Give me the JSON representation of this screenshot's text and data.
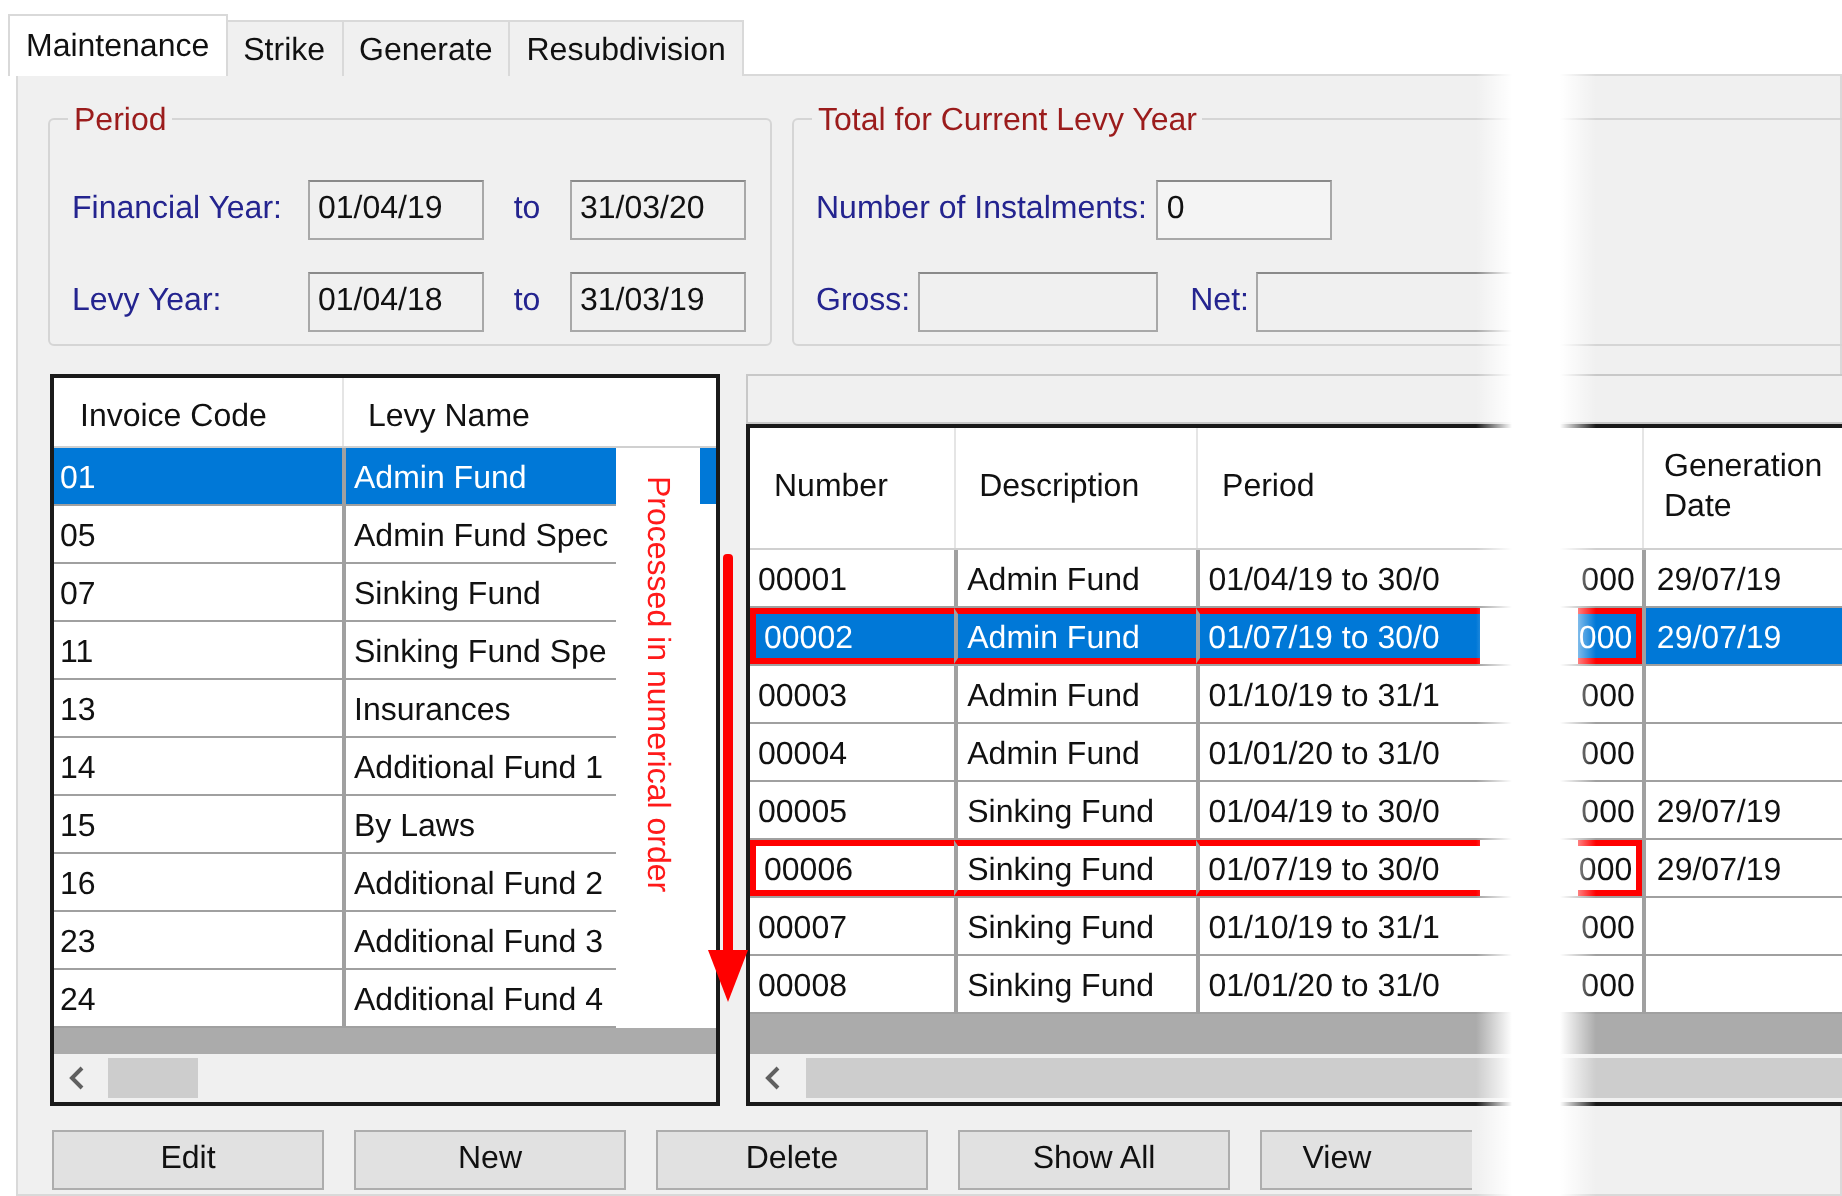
{
  "tabs": [
    {
      "label": "Maintenance",
      "selected": true
    },
    {
      "label": "Strike",
      "selected": false
    },
    {
      "label": "Generate",
      "selected": false
    },
    {
      "label": "Resubdivision",
      "selected": false
    }
  ],
  "period": {
    "title": "Period",
    "rows": [
      {
        "label": "Financial Year:",
        "from": "01/04/19",
        "to_label": "to",
        "to": "31/03/20"
      },
      {
        "label": "Levy Year:",
        "from": "01/04/18",
        "to_label": "to",
        "to": "31/03/19"
      }
    ]
  },
  "totals": {
    "title": "Total for Current Levy Year",
    "instalments": {
      "label": "Number of Instalments:",
      "value": "0"
    },
    "gross": {
      "label": "Gross:"
    },
    "net": {
      "label": "Net:"
    }
  },
  "levy_table": {
    "columns": [
      "Invoice Code",
      "Levy Name"
    ],
    "rows": [
      {
        "code": "01",
        "name": "Admin Fund",
        "selected": true
      },
      {
        "code": "05",
        "name": "Admin Fund Spec",
        "selected": false
      },
      {
        "code": "07",
        "name": "Sinking Fund",
        "selected": false
      },
      {
        "code": "11",
        "name": "Sinking Fund Spe",
        "selected": false
      },
      {
        "code": "13",
        "name": "Insurances",
        "selected": false
      },
      {
        "code": "14",
        "name": "Additional Fund 1",
        "selected": false
      },
      {
        "code": "15",
        "name": "By Laws",
        "selected": false
      },
      {
        "code": "16",
        "name": "Additional Fund 2",
        "selected": false
      },
      {
        "code": "23",
        "name": "Additional Fund 3",
        "selected": false
      },
      {
        "code": "24",
        "name": "Additional Fund 4",
        "selected": false
      }
    ]
  },
  "annotation": {
    "text": "Processed in numerical order"
  },
  "invoice_table": {
    "columns": [
      "Number",
      "Description",
      "Period",
      "Generation Date"
    ],
    "rows": [
      {
        "number": "00001",
        "description": "Admin Fund",
        "period": "01/04/19 to 30/0",
        "trailing_text": "000",
        "generation_date": "29/07/19",
        "selected": false,
        "highlighted": false
      },
      {
        "number": "00002",
        "description": "Admin Fund",
        "period": "01/07/19 to 30/0",
        "trailing_text": "000",
        "generation_date": "29/07/19",
        "selected": true,
        "highlighted": true
      },
      {
        "number": "00003",
        "description": "Admin Fund",
        "period": "01/10/19 to 31/1",
        "trailing_text": "000",
        "selected": false,
        "highlighted": false
      },
      {
        "number": "00004",
        "description": "Admin Fund",
        "period": "01/01/20 to 31/0",
        "trailing_text": "000",
        "selected": false,
        "highlighted": false
      },
      {
        "number": "00005",
        "description": "Sinking Fund",
        "period": "01/04/19 to 30/0",
        "trailing_text": "000",
        "generation_date": "29/07/19",
        "selected": false,
        "highlighted": false
      },
      {
        "number": "00006",
        "description": "Sinking Fund",
        "period": "01/07/19 to 30/0",
        "trailing_text": "000",
        "generation_date": "29/07/19",
        "selected": false,
        "highlighted": true
      },
      {
        "number": "00007",
        "description": "Sinking Fund",
        "period": "01/10/19 to 31/1",
        "trailing_text": "000",
        "selected": false,
        "highlighted": false
      },
      {
        "number": "00008",
        "description": "Sinking Fund",
        "period": "01/01/20 to 31/0",
        "trailing_text": "000",
        "selected": false,
        "highlighted": false
      }
    ]
  },
  "buttons": [
    "Edit",
    "New",
    "Delete",
    "Show All",
    "View"
  ]
}
